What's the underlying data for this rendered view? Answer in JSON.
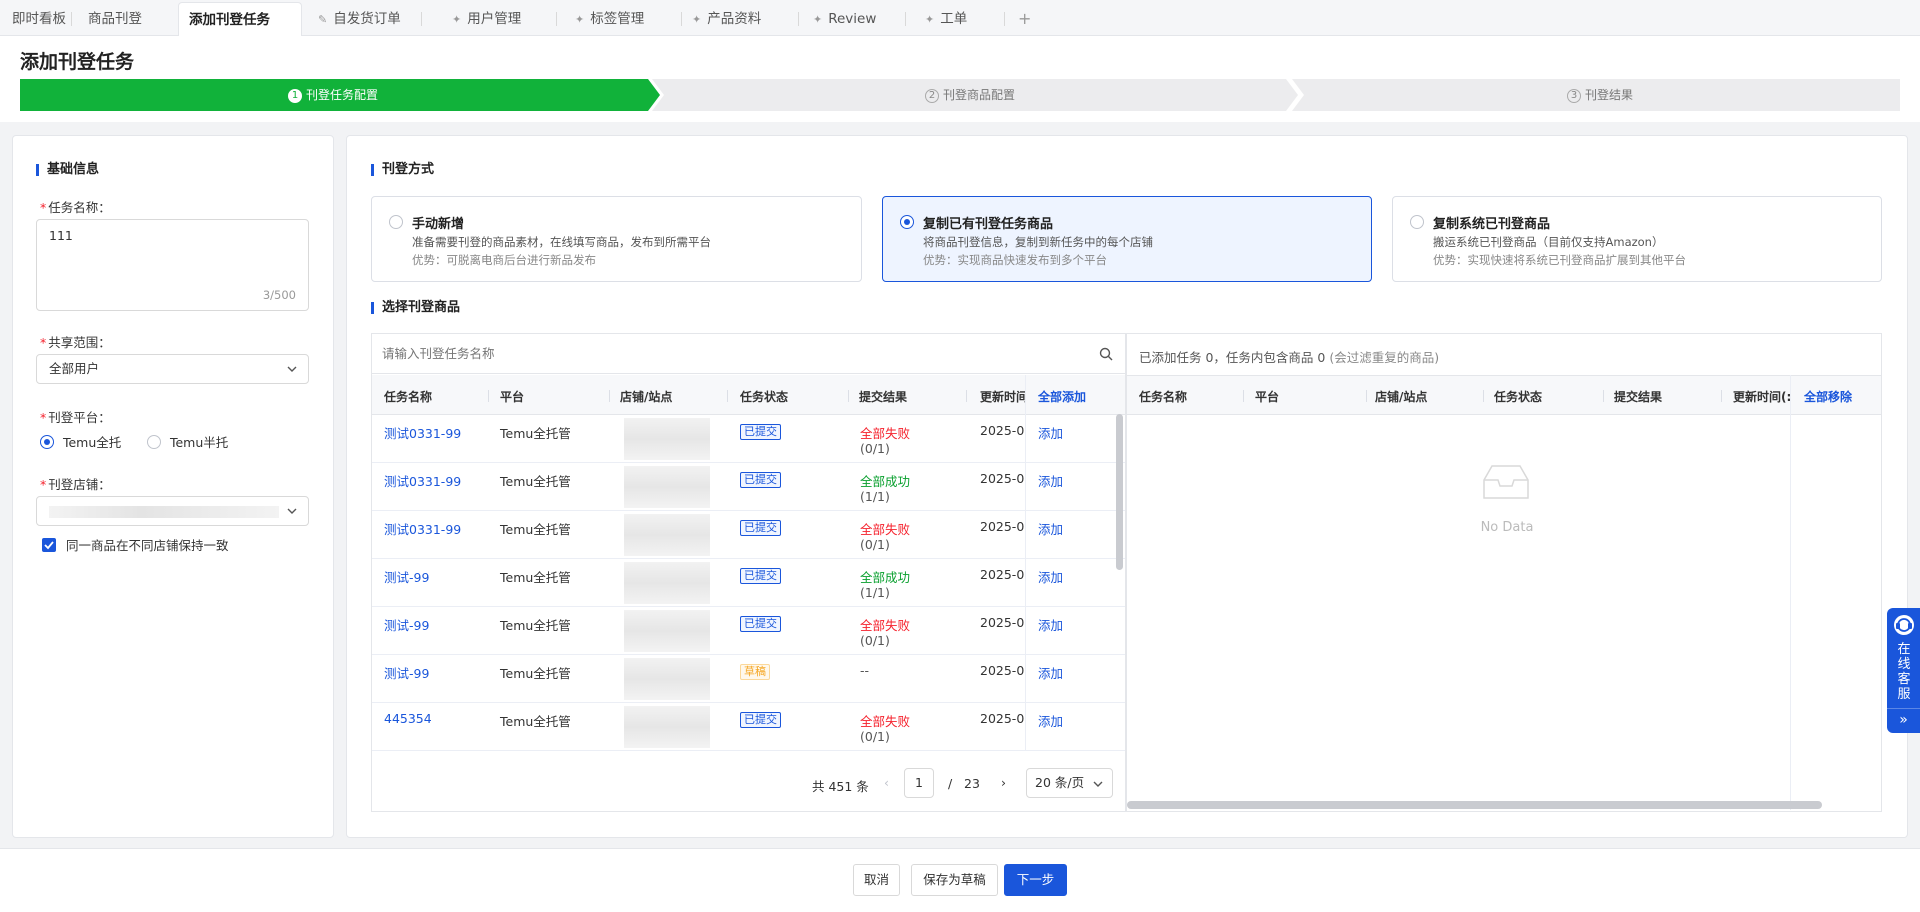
{
  "tabs": [
    {
      "label": "即时看板"
    },
    {
      "label": "商品刊登"
    },
    {
      "label": "添加刊登任务"
    },
    {
      "label": "自发货订单"
    },
    {
      "label": "用户管理"
    },
    {
      "label": "标签管理"
    },
    {
      "label": "产品资料"
    },
    {
      "label": "Review"
    },
    {
      "label": "工单"
    }
  ],
  "tab_add": "+",
  "page": {
    "title": "添加刊登任务"
  },
  "steps": [
    {
      "num": "1",
      "label": "刊登任务配置",
      "state": "active"
    },
    {
      "num": "2",
      "label": "刊登商品配置",
      "state": "pending"
    },
    {
      "num": "3",
      "label": "刊登结果",
      "state": "pending"
    }
  ],
  "basic": {
    "title": "基础信息",
    "task_name_label": "任务名称：",
    "task_name_value": "111",
    "task_name_count": "3/500",
    "share_label": "共享范围：",
    "share_value": "全部用户",
    "platform_label": "刊登平台：",
    "platform_options": [
      "Temu全托",
      "Temu半托"
    ],
    "store_label": "刊登店铺：",
    "consistency_label": "同一商品在不同店铺保持一致"
  },
  "method": {
    "title": "刊登方式",
    "options": [
      {
        "title": "手动新增",
        "desc": "准备需要刊登的商品素材，在线填写商品，发布到所需平台",
        "adv": "优势：可脱离电商后台进行新品发布"
      },
      {
        "title": "复制已有刊登任务商品",
        "desc": "将商品刊登信息，复制到新任务中的每个店铺",
        "adv": "优势：实现商品快速发布到多个平台"
      },
      {
        "title": "复制系统已刊登商品",
        "desc": "搬运系统已刊登商品（目前仅支持Amazon）",
        "adv": "优势：实现快速将系统已刊登商品扩展到其他平台"
      }
    ]
  },
  "select": {
    "title": "选择刊登商品",
    "search_placeholder": "请输入刊登任务名称",
    "columns": [
      "任务名称",
      "平台",
      "店铺/站点",
      "任务状态",
      "提交结果",
      "更新时间"
    ],
    "add_all": "全部添加",
    "rows": [
      {
        "name": "测试0331-99",
        "platform": "Temu全托管",
        "status": "已提交",
        "result": "全部失败",
        "result_count": "(0/1)",
        "result_type": "fail",
        "time": "2025-0",
        "action": "添加"
      },
      {
        "name": "测试0331-99",
        "platform": "Temu全托管",
        "status": "已提交",
        "result": "全部成功",
        "result_count": "(1/1)",
        "result_type": "success",
        "time": "2025-0",
        "action": "添加"
      },
      {
        "name": "测试0331-99",
        "platform": "Temu全托管",
        "status": "已提交",
        "result": "全部失败",
        "result_count": "(0/1)",
        "result_type": "fail",
        "time": "2025-0",
        "action": "添加"
      },
      {
        "name": "测试-99",
        "platform": "Temu全托管",
        "status": "已提交",
        "result": "全部成功",
        "result_count": "(1/1)",
        "result_type": "success",
        "time": "2025-0",
        "action": "添加"
      },
      {
        "name": "测试-99",
        "platform": "Temu全托管",
        "status": "已提交",
        "result": "全部失败",
        "result_count": "(0/1)",
        "result_type": "fail",
        "time": "2025-0",
        "action": "添加"
      },
      {
        "name": "测试-99",
        "platform": "Temu全托管",
        "status": "草稿",
        "result": "--",
        "result_count": "",
        "result_type": "none",
        "time": "2025-0",
        "action": "添加"
      },
      {
        "name": "445354",
        "platform": "Temu全托管",
        "status": "已提交",
        "result": "全部失败",
        "result_count": "(0/1)",
        "result_type": "fail",
        "time": "2025-0",
        "action": "添加"
      }
    ],
    "pagination": {
      "total": "共 451 条",
      "current": "1",
      "separator": "/",
      "pages": "23",
      "page_size": "20 条/页"
    }
  },
  "selected": {
    "summary": "已添加任务 0，任务内包含商品 0",
    "summary_note": "(会过滤重复的商品)",
    "columns": [
      "任务名称",
      "平台",
      "店铺/站点",
      "任务状态",
      "提交结果",
      "更新时间(:"
    ],
    "remove_all": "全部移除",
    "empty_text": "No Data"
  },
  "footer": {
    "cancel": "取消",
    "save_draft": "保存为草稿",
    "next": "下一步"
  },
  "customer_service": {
    "label": "在线客服",
    "expand": "»"
  },
  "colors": {
    "accent": "#1a56db",
    "step_active": "#11b23a",
    "fail": "#f5222d",
    "success": "#0aa02f"
  }
}
